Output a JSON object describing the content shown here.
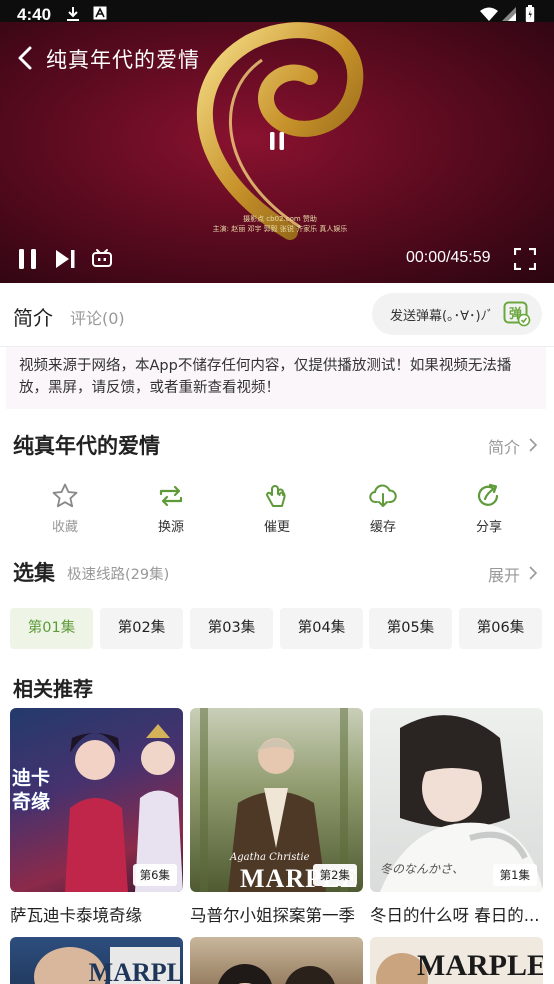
{
  "status_bar": {
    "time": "4:40"
  },
  "player": {
    "title": "纯真年代的爱情",
    "credits_line1": "摄影点 cb02.com 赞助",
    "credits_line2": "主演: 赵丽 邓宇 郭毅 张锐 齐家乐 真人娱乐",
    "time": "00:00/45:59"
  },
  "tabs": {
    "intro": "简介",
    "comments": "评论(0)",
    "danmaku_placeholder": "发送弹幕(｡･∀･)ﾉﾞ",
    "danmaku_icon_char": "弹"
  },
  "notice": "视频来源于网络，本App不储存任何内容，仅提供播放测试！如果视频无法播放，黑屏，请反馈，或者重新查看视频！",
  "show": {
    "title": "纯真年代的爱情",
    "intro_link": "简介"
  },
  "actions": [
    {
      "label": "收藏",
      "icon": "star-icon"
    },
    {
      "label": "换源",
      "icon": "switch-source-icon"
    },
    {
      "label": "催更",
      "icon": "urge-update-icon"
    },
    {
      "label": "缓存",
      "icon": "download-cache-icon"
    },
    {
      "label": "分享",
      "icon": "share-icon"
    }
  ],
  "episodes": {
    "header": "选集",
    "line": "极速线路(29集)",
    "expand": "展开",
    "items": [
      "第01集",
      "第02集",
      "第03集",
      "第04集",
      "第05集",
      "第06集"
    ],
    "selected": "第01集"
  },
  "related": {
    "header": "相关推荐",
    "items": [
      {
        "title": "萨瓦迪卡泰境奇缘",
        "tag": "第6集",
        "poster_text": "迪卡\n奇缘"
      },
      {
        "title": "马普尔小姐探案第一季",
        "tag": "第2集",
        "poster_text": "MARPLE",
        "poster_sub": "Agatha Christie"
      },
      {
        "title": "冬日的什么呀 春日的...",
        "tag": "第1集",
        "poster_text": "冬のなんかさ、"
      }
    ],
    "row2_posters": [
      "",
      "",
      "MARPLE"
    ]
  },
  "colors": {
    "accent": "#5e9a3a",
    "player_bg": "#5e0b20"
  }
}
